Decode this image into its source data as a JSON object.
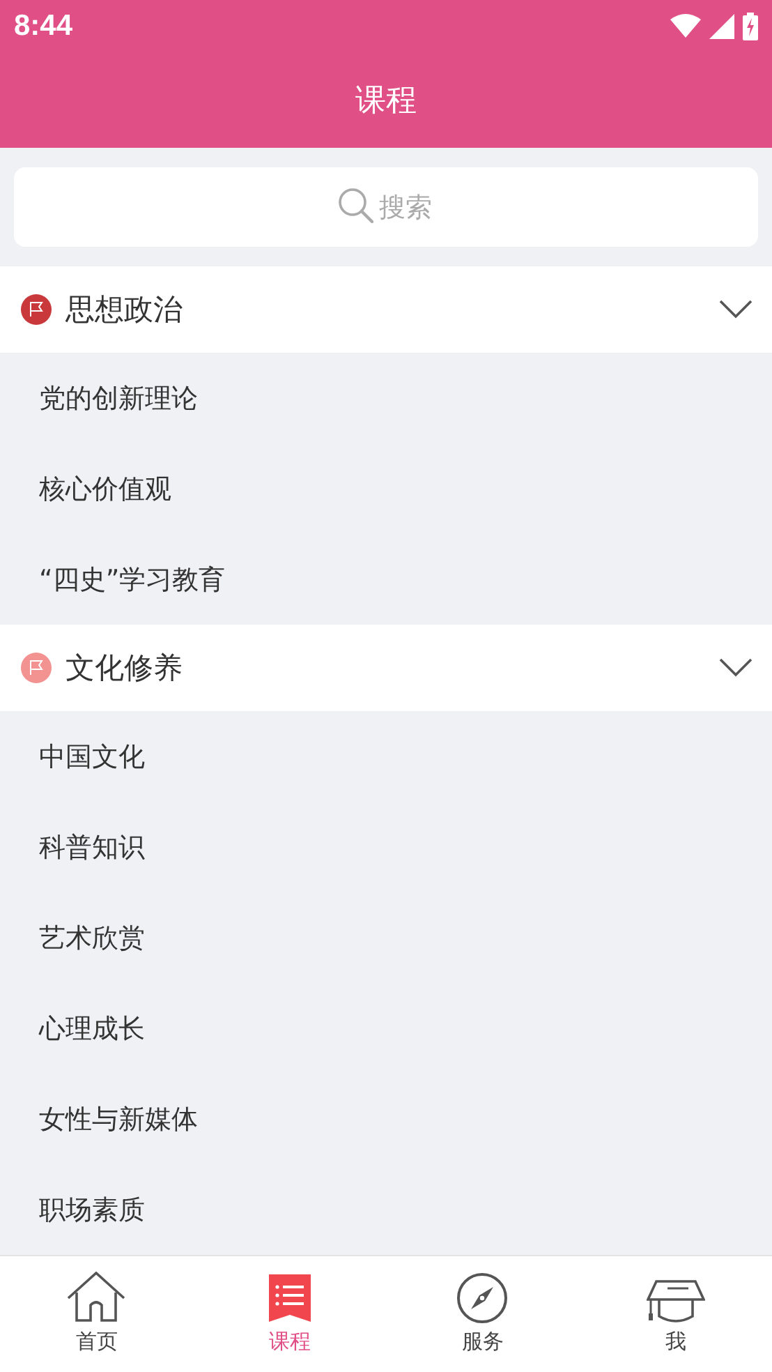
{
  "status_bar": {
    "time": "8:44"
  },
  "header": {
    "title": "课程"
  },
  "search": {
    "placeholder": "搜索"
  },
  "sections": [
    {
      "title": "思想政治",
      "color": "#c9383b",
      "expanded": true,
      "items": [
        "党的创新理论",
        "核心价值观",
        "“四史”学习教育"
      ]
    },
    {
      "title": "文化修养",
      "color": "#f29391",
      "expanded": true,
      "items": [
        "中国文化",
        "科普知识",
        "艺术欣赏",
        "心理成长",
        "女性与新媒体",
        "职场素质"
      ]
    }
  ],
  "tabs": [
    {
      "kind": "home",
      "label": "首页",
      "selected": false
    },
    {
      "kind": "courses",
      "label": "课程",
      "selected": true
    },
    {
      "kind": "services",
      "label": "服务",
      "selected": false
    },
    {
      "kind": "me",
      "label": "我",
      "selected": false
    }
  ]
}
